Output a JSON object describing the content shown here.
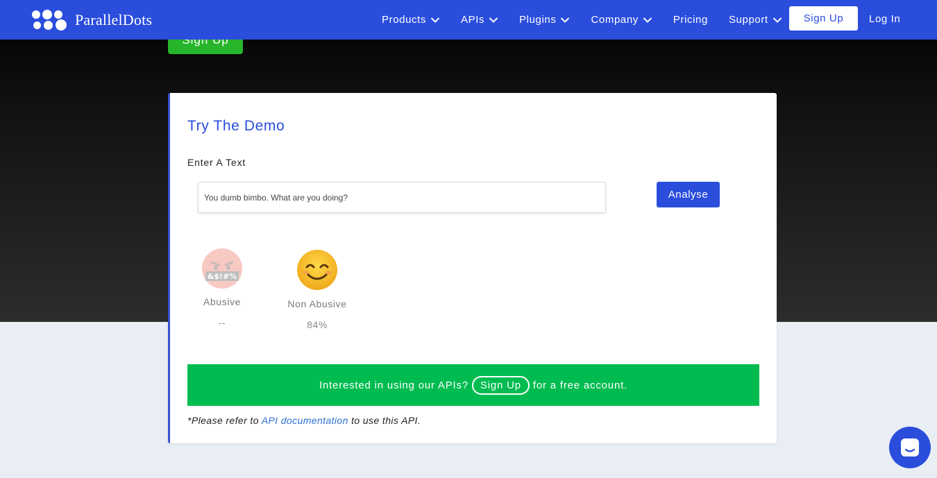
{
  "brand": {
    "name": "ParallelDots",
    "accent": "#2a4ddc"
  },
  "nav": {
    "items": [
      {
        "label": "Products",
        "dropdown": true
      },
      {
        "label": "APIs",
        "dropdown": true
      },
      {
        "label": "Plugins",
        "dropdown": true
      },
      {
        "label": "Company",
        "dropdown": true
      },
      {
        "label": "Pricing",
        "dropdown": false
      },
      {
        "label": "Support",
        "dropdown": true
      }
    ],
    "signup": "Sign Up",
    "login": "Log In"
  },
  "hero": {
    "signup": "Sign Up"
  },
  "demo": {
    "title": "Try The Demo",
    "input_label": "Enter A Text",
    "input_value": "You dumb bimbo. What are you doing?",
    "analyse": "Analyse",
    "results": [
      {
        "label": "Abusive",
        "value": "--",
        "icon": "angry-swearing-face-icon"
      },
      {
        "label": "Non Abusive",
        "value": "84%",
        "icon": "smiling-face-icon"
      }
    ],
    "banner": {
      "before": "Interested in using our APIs?",
      "link": "Sign Up",
      "after": "for a free account."
    },
    "note": {
      "before": "*Please refer to",
      "link": "API documentation",
      "after": "to use this API."
    }
  },
  "colors": {
    "banner_green": "#00bc50",
    "hero_signup_green": "#26b52b"
  }
}
